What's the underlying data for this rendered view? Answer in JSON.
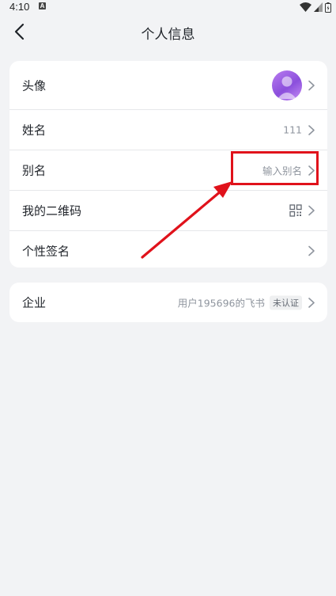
{
  "status_bar": {
    "time": "4:10",
    "app_badge": "A"
  },
  "nav": {
    "title": "个人信息",
    "back_icon": "chevron-left-icon"
  },
  "profile_rows": [
    {
      "label": "头像",
      "value": "",
      "type": "avatar"
    },
    {
      "label": "姓名",
      "value": "111"
    },
    {
      "label": "别名",
      "value": "输入别名"
    },
    {
      "label": "我的二维码",
      "value": "",
      "icon": "qr-code-icon"
    },
    {
      "label": "个性签名",
      "value": ""
    }
  ],
  "enterprise": {
    "label": "企业",
    "value": "用户195696的飞书",
    "badge": "未认证"
  },
  "colors": {
    "background": "#f2f3f5",
    "card": "#ffffff",
    "annotation": "#e0121b",
    "avatar": "#a66ae8"
  }
}
